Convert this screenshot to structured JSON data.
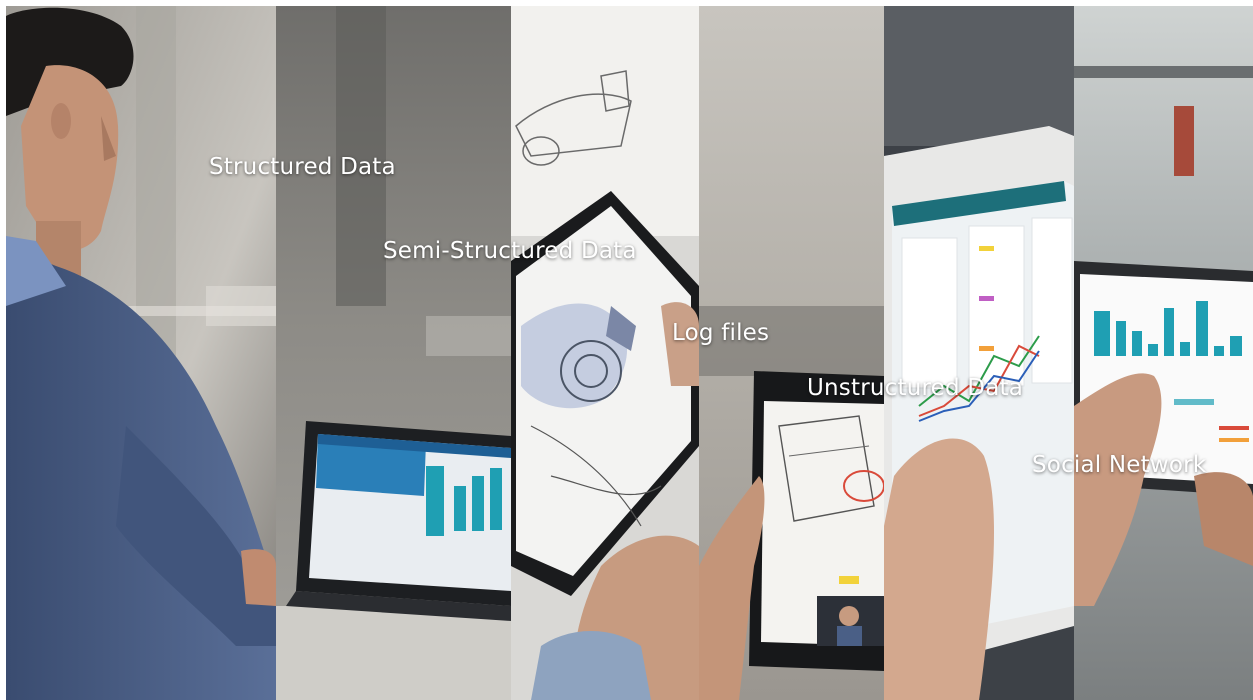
{
  "labels": {
    "structured": "Structured Data",
    "semi_structured": "Semi-Structured Data",
    "log_files": "Log files",
    "unstructured": "Unstructured Data",
    "social_network": "Social Network"
  },
  "colors": {
    "shirt_blue": "#4a5f86",
    "office_grey": "#b9b6b1",
    "screen_blue": "#2a7fb8",
    "teal_bar": "#1f9fb3",
    "sketch_paper": "#f1f1f0",
    "red_sketch": "#d94a3a",
    "dashboard_bg": "#eef2f4"
  },
  "icons": {
    "laptop": "laptop-icon",
    "tablet": "tablet-icon",
    "bar_chart": "bar-chart-icon",
    "line_chart": "line-chart-icon"
  }
}
